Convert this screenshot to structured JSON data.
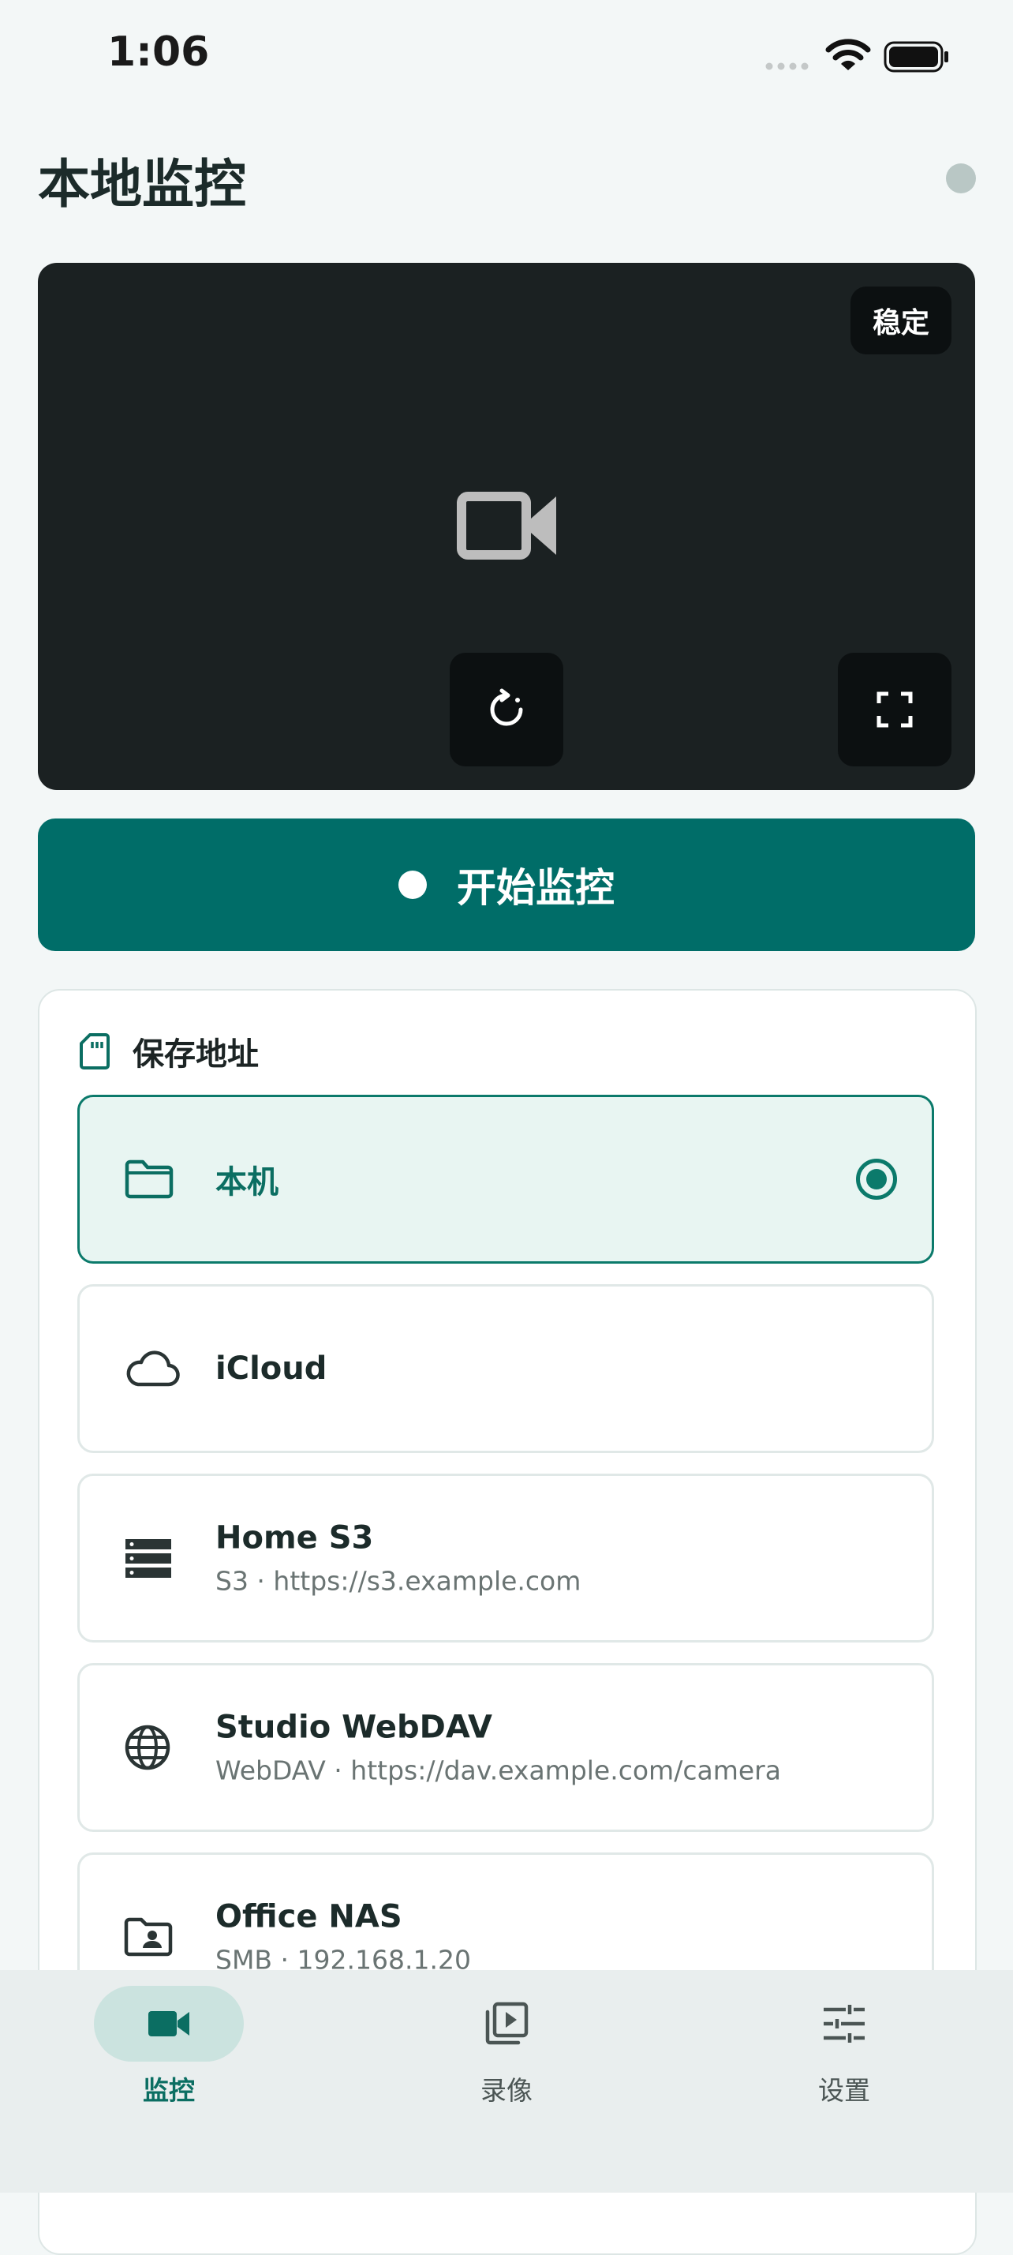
{
  "status_bar": {
    "time": "1:06"
  },
  "header": {
    "title": "本地监控"
  },
  "preview": {
    "badge": "稳定",
    "icons": [
      "video-camera-icon",
      "rotate-camera-icon",
      "fullscreen-icon"
    ]
  },
  "start_button": {
    "label": "开始监控"
  },
  "storage": {
    "title": "保存地址",
    "options": [
      {
        "name": "本机",
        "subtitle": "",
        "icon": "folder-icon",
        "selected": true
      },
      {
        "name": "iCloud",
        "subtitle": "",
        "icon": "cloud-icon",
        "selected": false
      },
      {
        "name": "Home S3",
        "subtitle": "S3 · https://s3.example.com",
        "icon": "server-icon",
        "selected": false
      },
      {
        "name": "Studio WebDAV",
        "subtitle": "WebDAV · https://dav.example.com/camera",
        "icon": "globe-icon",
        "selected": false
      },
      {
        "name": "Office NAS",
        "subtitle": "SMB · 192.168.1.20",
        "icon": "shared-folder-icon",
        "selected": false
      }
    ]
  },
  "nav": {
    "items": [
      {
        "label": "监控",
        "icon": "video-icon",
        "active": true
      },
      {
        "label": "录像",
        "icon": "playlist-icon",
        "active": false
      },
      {
        "label": "设置",
        "icon": "sliders-icon",
        "active": false
      }
    ]
  },
  "colors": {
    "accent": "#006d68",
    "preview_bg": "#1b2122",
    "selected_bg": "#e8f5f2"
  }
}
